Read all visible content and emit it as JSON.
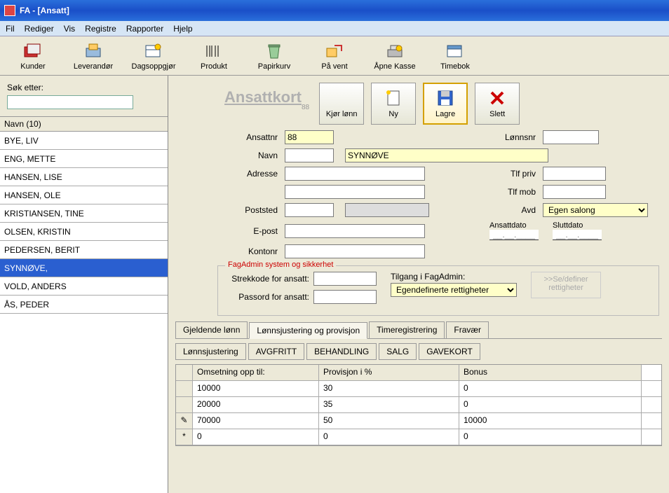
{
  "window": {
    "title": "FA - [Ansatt]"
  },
  "menu": [
    "Fil",
    "Rediger",
    "Vis",
    "Registre",
    "Rapporter",
    "Hjelp"
  ],
  "toolbar": [
    {
      "name": "kunder",
      "label": "Kunder"
    },
    {
      "name": "leverandor",
      "label": "Leverandør"
    },
    {
      "name": "dagsoppgjor",
      "label": "Dagsoppgjør"
    },
    {
      "name": "produkt",
      "label": "Produkt"
    },
    {
      "name": "papirkurv",
      "label": "Papirkurv"
    },
    {
      "name": "paavent",
      "label": "På vent"
    },
    {
      "name": "apnekasse",
      "label": "Åpne Kasse"
    },
    {
      "name": "timebok",
      "label": "Timebok"
    }
  ],
  "search": {
    "label": "Søk etter:",
    "value": ""
  },
  "list": {
    "header": "Navn (10)",
    "items": [
      "BYE, LIV",
      "ENG, METTE",
      "HANSEN, LISE",
      "HANSEN, OLE",
      "KRISTIANSEN, TINE",
      "OLSEN, KRISTIN",
      "PEDERSEN, BERIT",
      "SYNNØVE,",
      "VOLD, ANDERS",
      "ÅS, PEDER"
    ],
    "selectedIndex": 7
  },
  "page": {
    "title": "Ansattkort",
    "subId": "88"
  },
  "actions": {
    "run": "Kjør lønn",
    "new": "Ny",
    "save": "Lagre",
    "delete": "Slett"
  },
  "form": {
    "ansattnr_label": "Ansattnr",
    "ansattnr_value": "88",
    "lonnsnr_label": "Lønnsnr",
    "lonnsnr_value": "",
    "navn_label": "Navn",
    "navn_first": "",
    "navn_last": "SYNNØVE",
    "adresse_label": "Adresse",
    "adresse1": "",
    "adresse2": "",
    "tlfpriv_label": "Tlf priv",
    "tlfpriv": "",
    "tlfmob_label": "Tlf mob",
    "tlfmob": "",
    "poststed_label": "Poststed",
    "poststed_code": "",
    "poststed_name": "",
    "avd_label": "Avd",
    "avd_value": "Egen salong",
    "epost_label": "E-post",
    "epost": "",
    "kontonr_label": "Kontonr",
    "kontonr": "",
    "ansattdato_label": "Ansattdato",
    "ansattdato": "__.__.____",
    "sluttdato_label": "Sluttdato",
    "sluttdato": "__.__.____"
  },
  "security": {
    "legend": "FagAdmin system og sikkerhet",
    "barcode_label": "Strekkode for ansatt:",
    "barcode": "",
    "password_label": "Passord for ansatt:",
    "password": "",
    "access_label": "Tilgang i FagAdmin:",
    "access_value": "Egendefinerte rettigheter",
    "rights_button": ">>Se/definer rettigheter"
  },
  "tabs": {
    "items": [
      "Gjeldende lønn",
      "Lønnsjustering og provisjon",
      "Timeregistrering",
      "Fravær"
    ],
    "activeIndex": 1
  },
  "subtabs": [
    "Lønnsjustering",
    "AVGFRITT",
    "BEHANDLING",
    "SALG",
    "GAVEKORT"
  ],
  "grid": {
    "columns": [
      "Omsetning opp til:",
      "Provisjon i %",
      "Bonus"
    ],
    "rows": [
      {
        "mark": "",
        "c1": "10000",
        "c2": "30",
        "c3": "0"
      },
      {
        "mark": "",
        "c1": "20000",
        "c2": "35",
        "c3": "0"
      },
      {
        "mark": "✎",
        "c1": "70000",
        "c2": "50",
        "c3": "10000"
      },
      {
        "mark": "*",
        "c1": "0",
        "c2": "0",
        "c3": "0"
      }
    ]
  }
}
